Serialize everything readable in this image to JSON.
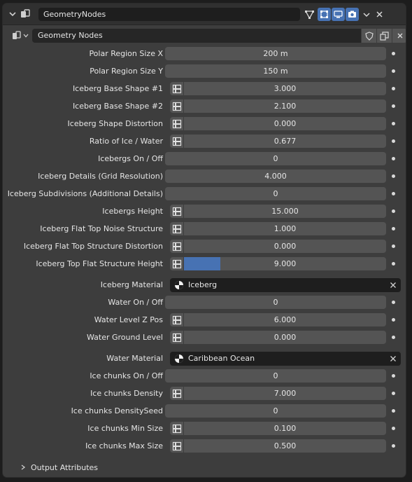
{
  "header": {
    "modifier_name": "GeometryNodes"
  },
  "node_group": {
    "name": "Geometry Nodes"
  },
  "rows": [
    {
      "label": "Polar Region Size X",
      "value": "200 m",
      "type": "number",
      "icon": false,
      "fill": 0
    },
    {
      "label": "Polar Region Size Y",
      "value": "150 m",
      "type": "number",
      "icon": false,
      "fill": 0
    },
    {
      "label": "Iceberg Base Shape #1",
      "value": "3.000",
      "type": "number",
      "icon": true,
      "fill": 0
    },
    {
      "label": "Iceberg Base Shape #2",
      "value": "2.100",
      "type": "number",
      "icon": true,
      "fill": 0
    },
    {
      "label": "Iceberg Shape Distortion",
      "value": "0.000",
      "type": "number",
      "icon": true,
      "fill": 0
    },
    {
      "label": "Ratio of Ice / Water",
      "value": "0.677",
      "type": "number",
      "icon": true,
      "fill": 0
    },
    {
      "label": "Icebergs On / Off",
      "value": "0",
      "type": "number",
      "icon": false,
      "fill": 0
    },
    {
      "label": "Iceberg Details (Grid Resolution)",
      "value": "4.000",
      "type": "number",
      "icon": false,
      "fill": 0
    },
    {
      "label": "Iceberg Subdivisions (Additional Details)",
      "value": "0",
      "type": "number",
      "icon": false,
      "fill": 0
    },
    {
      "label": "Icebergs Height",
      "value": "15.000",
      "type": "number",
      "icon": true,
      "fill": 0
    },
    {
      "label": "Iceberg Flat Top Noise Structure",
      "value": "1.000",
      "type": "number",
      "icon": true,
      "fill": 0
    },
    {
      "label": "Iceberg Flat Top Structure Distortion",
      "value": "0.000",
      "type": "number",
      "icon": true,
      "fill": 0
    },
    {
      "label": "Iceberg Top Flat Structure Height",
      "value": "9.000",
      "type": "number",
      "icon": true,
      "fill": 0.18
    },
    {
      "label": "Iceberg Material",
      "value": "Iceberg",
      "type": "material"
    },
    {
      "label": "Water On / Off",
      "value": "0",
      "type": "number",
      "icon": false,
      "fill": 0
    },
    {
      "label": "Water Level Z Pos",
      "value": "6.000",
      "type": "number",
      "icon": true,
      "fill": 0
    },
    {
      "label": "Water Ground Level",
      "value": "0.000",
      "type": "number",
      "icon": true,
      "fill": 0
    },
    {
      "label": "Water Material",
      "value": "Caribbean Ocean",
      "type": "material"
    },
    {
      "label": "Ice chunks On / Off",
      "value": "0",
      "type": "number",
      "icon": false,
      "fill": 0
    },
    {
      "label": "Ice chunks Density",
      "value": "7.000",
      "type": "number",
      "icon": true,
      "fill": 0
    },
    {
      "label": "Ice chunks DensitySeed",
      "value": "0",
      "type": "number",
      "icon": false,
      "fill": 0
    },
    {
      "label": "Ice chunks Min Size",
      "value": "0.100",
      "type": "number",
      "icon": true,
      "fill": 0
    },
    {
      "label": "Ice chunks Max Size",
      "value": "0.500",
      "type": "number",
      "icon": true,
      "fill": 0
    }
  ],
  "footer": {
    "label": "Output Attributes"
  },
  "colors": {
    "accent": "#4772b3",
    "panel": "#3d3d3d",
    "field": "#545454",
    "dark_field": "#1e1e1e"
  }
}
